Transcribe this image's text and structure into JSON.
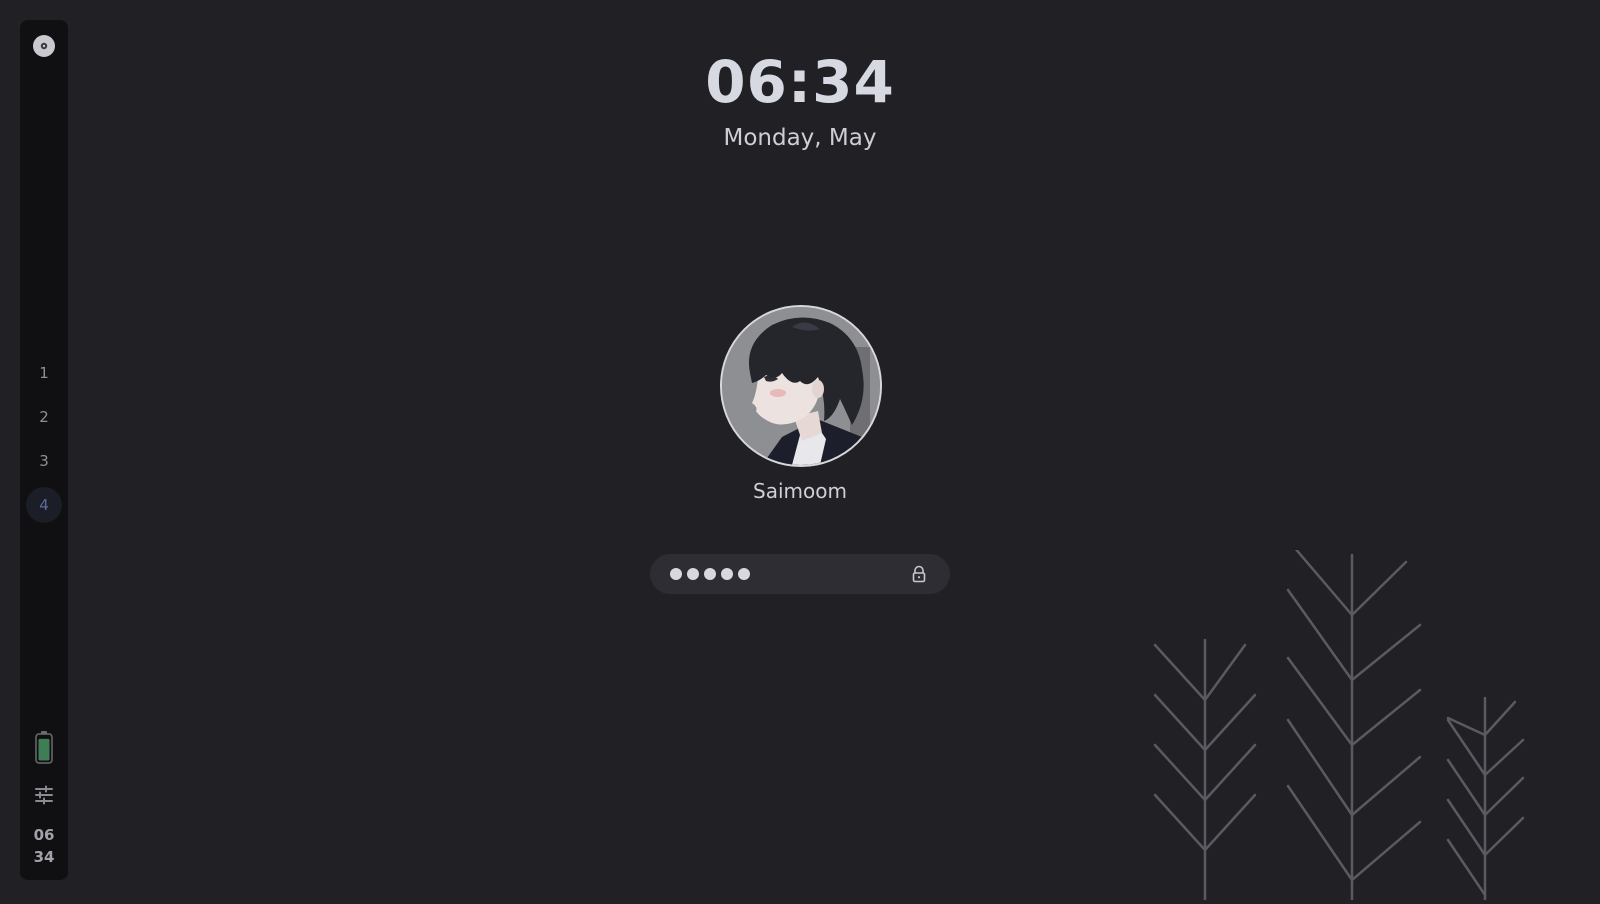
{
  "lockscreen": {
    "time": "06:34",
    "date": "Monday, May",
    "username": "Saimoom",
    "password_mask_count": 5
  },
  "sidebar": {
    "top_icon": "disc-icon",
    "workspaces": [
      {
        "label": "1",
        "active": false
      },
      {
        "label": "2",
        "active": false
      },
      {
        "label": "3",
        "active": false
      },
      {
        "label": "4",
        "active": true
      }
    ],
    "battery": {
      "icon": "battery-icon",
      "level": 0.9,
      "color": "#3f7d57"
    },
    "settings_icon": "tune-icon",
    "clock_hour": "06",
    "clock_minute": "34"
  },
  "colors": {
    "background": "#202025",
    "sidebar": "#101012",
    "accent": "#5d6aa0",
    "tree_lines": "#5a5a60"
  }
}
